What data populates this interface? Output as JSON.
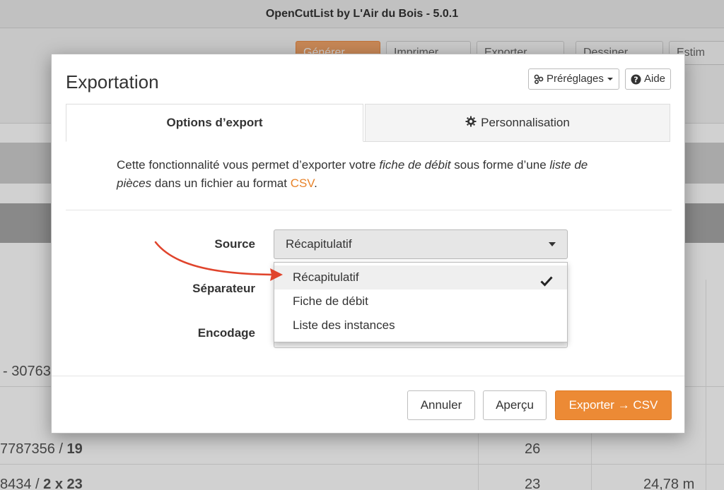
{
  "window": {
    "title": "OpenCutList by L'Air du Bois - 5.0.1"
  },
  "background": {
    "toolbar": [
      {
        "label": "Générer"
      },
      {
        "label": "Imprimer"
      },
      {
        "label": "Exporter"
      },
      {
        "label": "Dessiner"
      },
      {
        "label": "Estim"
      }
    ],
    "rows": [
      {
        "left": "- 30763"
      },
      {
        "left": "7787356 / ",
        "bold": "19",
        "qty": "26"
      },
      {
        "left": "8434 / ",
        "bold": "2 x 23",
        "qty": "23",
        "length": "24,78 m"
      }
    ]
  },
  "modal": {
    "title": "Exportation",
    "presets_label": "Préréglages",
    "help_label": "Aide",
    "tabs": [
      {
        "label": "Options d’export",
        "active": true
      },
      {
        "label": "Personnalisation",
        "active": false
      }
    ],
    "intro": {
      "part1": "Cette fonctionnalité vous permet d’exporter votre ",
      "em1": "fiche de débit",
      "part2": " sous forme d’une ",
      "em2": "liste de pièces",
      "part3": " dans un fichier au format ",
      "link": "CSV",
      "part4": "."
    },
    "form": {
      "source_label": "Source",
      "separator_label": "Séparateur",
      "encoding_label": "Encodage",
      "source_value": "Récapitulatif",
      "source_options": [
        {
          "label": "Récapitulatif",
          "selected": true
        },
        {
          "label": "Fiche de débit",
          "selected": false
        },
        {
          "label": "Liste des instances",
          "selected": false
        }
      ]
    },
    "footer": {
      "cancel_label": "Annuler",
      "preview_label": "Aperçu",
      "export_label": "Exporter → CSV"
    }
  },
  "colors": {
    "accent": "#ec8a35",
    "link": "#e8832a",
    "annotation_arrow": "#e0442c"
  },
  "icons": [
    "presets-icon",
    "chevron-down-icon",
    "help-icon",
    "gear-icon",
    "checkmark-icon",
    "annotation-arrow"
  ]
}
